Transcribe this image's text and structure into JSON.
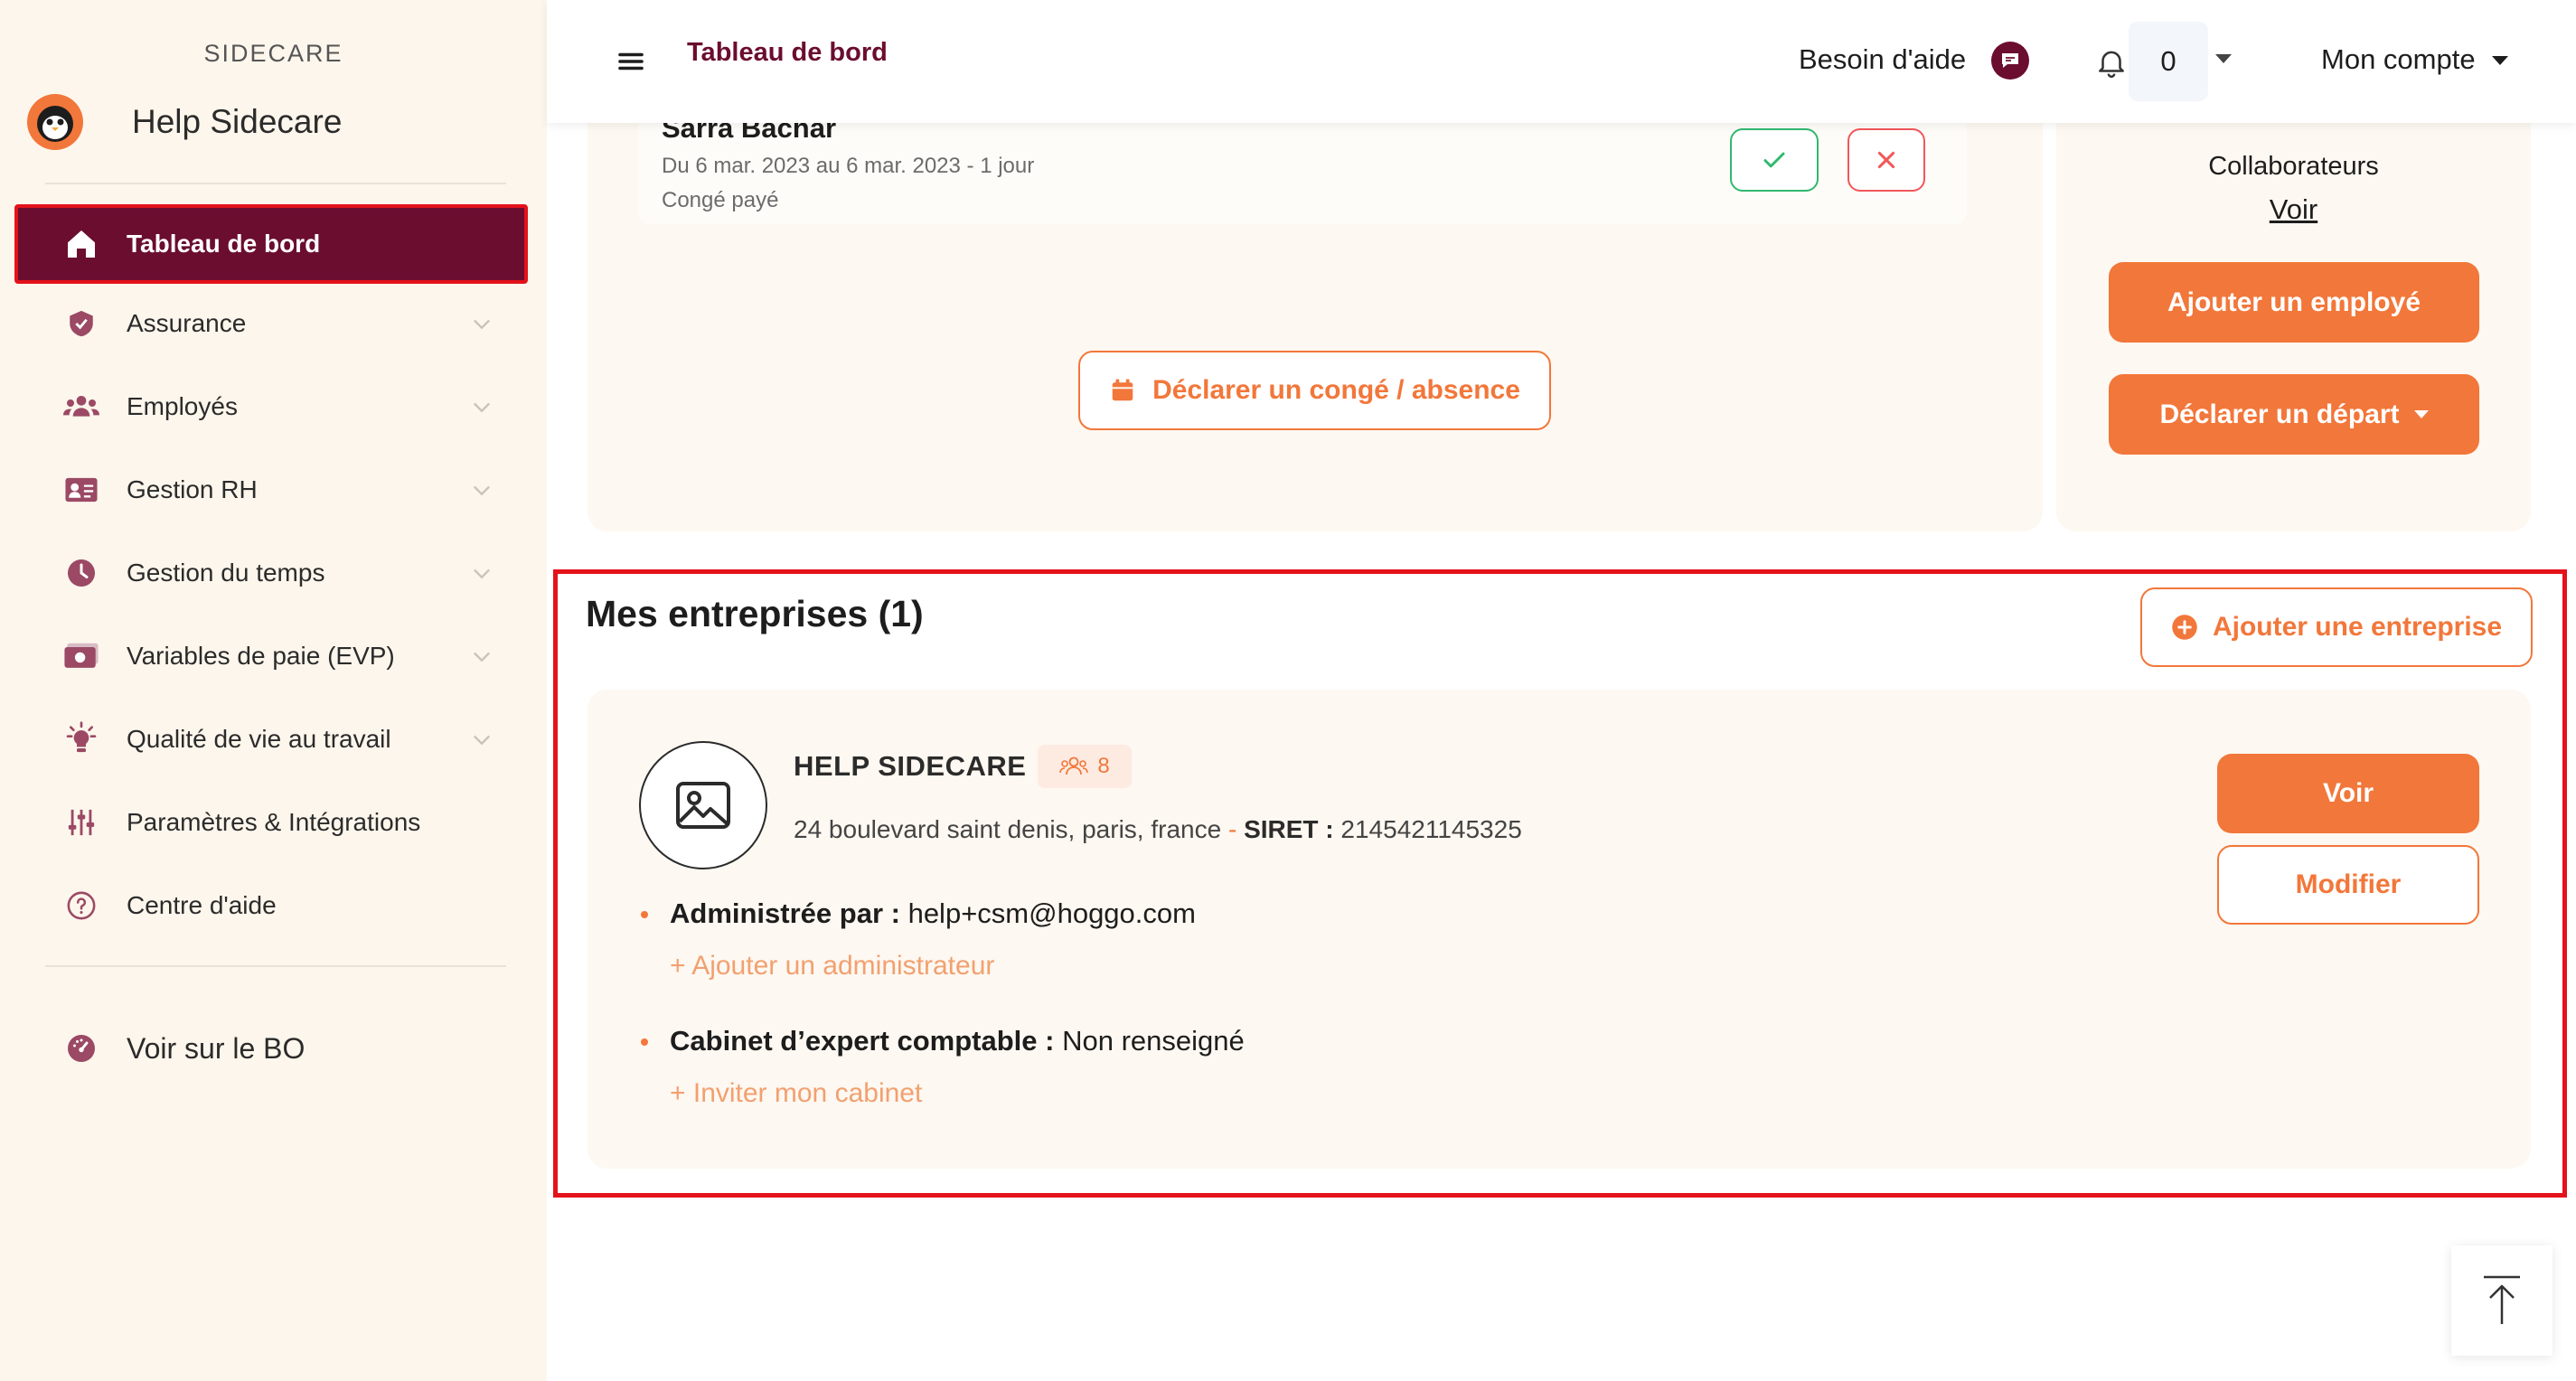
{
  "sidebar": {
    "brand_small": "SIDECARE",
    "brand_name": "Help Sidecare",
    "items": [
      {
        "label": "Tableau de bord"
      },
      {
        "label": "Assurance"
      },
      {
        "label": "Employés"
      },
      {
        "label": "Gestion RH"
      },
      {
        "label": "Gestion du temps"
      },
      {
        "label": "Variables de paie (EVP)"
      },
      {
        "label": "Qualité de vie au travail"
      },
      {
        "label": "Paramètres & Intégrations"
      },
      {
        "label": "Centre d'aide"
      }
    ],
    "bo_label": "Voir sur le BO"
  },
  "topbar": {
    "title": "Tableau de bord",
    "help": "Besoin d'aide",
    "notif_count": "0",
    "account": "Mon compte"
  },
  "leave": {
    "name": "Sarra Bachar",
    "dates": "Du 6 mar. 2023 au 6 mar. 2023 - 1 jour",
    "type": "Congé payé",
    "declare_button": "Déclarer un congé / absence"
  },
  "collaborators": {
    "title": "Collaborateurs",
    "link": "Voir",
    "add_employee": "Ajouter un employé",
    "declare_departure": "Déclarer un départ"
  },
  "companies": {
    "title": "Mes entreprises (1)",
    "add_company": "Ajouter une entreprise",
    "company": {
      "name": "HELP SIDECARE",
      "employee_count": "8",
      "address": "24 boulevard saint denis, paris, france",
      "separator": " - ",
      "siret_label": "SIRET :",
      "siret": "2145421145325",
      "admin_label": "Administrée par :",
      "admin_value": "help+csm@hoggo.com",
      "add_admin": "+ Ajouter un administrateur",
      "accountant_label": "Cabinet d’expert comptable :",
      "accountant_value": "Non renseigné",
      "invite_accountant": "+ Inviter mon cabinet",
      "view_button": "Voir",
      "edit_button": "Modifier"
    }
  },
  "colors": {
    "primary": "#6b0d2f",
    "accent": "#f2773a",
    "highlight": "#e4121b",
    "approve": "#30b86f",
    "reject": "#f0575a"
  }
}
